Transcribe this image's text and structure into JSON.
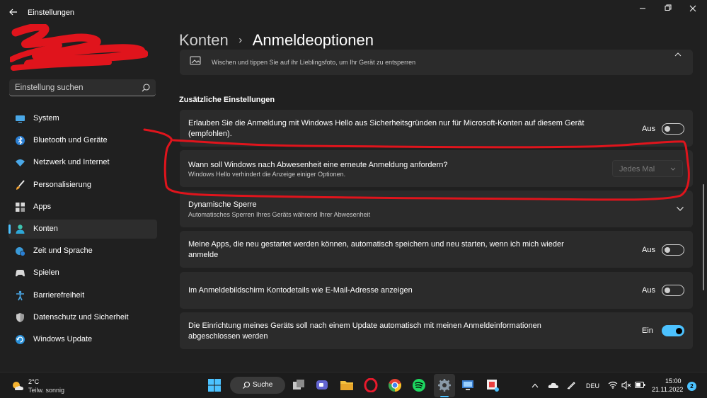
{
  "window": {
    "title": "Einstellungen"
  },
  "search": {
    "placeholder": "Einstellung suchen"
  },
  "sidebar": {
    "items": [
      {
        "label": "System",
        "icon": "monitor-icon"
      },
      {
        "label": "Bluetooth und Geräte",
        "icon": "bluetooth-icon"
      },
      {
        "label": "Netzwerk und Internet",
        "icon": "wifi-icon"
      },
      {
        "label": "Personalisierung",
        "icon": "brush-icon"
      },
      {
        "label": "Apps",
        "icon": "apps-icon"
      },
      {
        "label": "Konten",
        "icon": "person-icon",
        "active": true
      },
      {
        "label": "Zeit und Sprache",
        "icon": "globe-clock-icon"
      },
      {
        "label": "Spielen",
        "icon": "gamepad-icon"
      },
      {
        "label": "Barrierefreiheit",
        "icon": "accessibility-icon"
      },
      {
        "label": "Datenschutz und Sicherheit",
        "icon": "shield-icon"
      },
      {
        "label": "Windows Update",
        "icon": "update-icon"
      }
    ]
  },
  "header": {
    "parent": "Konten",
    "separator": "›",
    "current": "Anmeldeoptionen"
  },
  "main": {
    "partial_card_sub": "Wischen und tippen Sie auf ihr Lieblingsfoto, um Ihr Gerät zu entsperren",
    "section_title": "Zusätzliche Einstellungen",
    "hello_only": {
      "title": "Erlauben Sie die Anmeldung mit Windows Hello aus Sicherheitsgründen nur für Microsoft-Konten auf diesem Gerät (empfohlen).",
      "state": "Aus"
    },
    "reauth": {
      "title": "Wann soll Windows nach Abwesenheit eine erneute Anmeldung anfordern?",
      "sub": "Windows Hello verhindert die Anzeige einiger Optionen.",
      "value": "Jedes Mal"
    },
    "dynamic_lock": {
      "title": "Dynamische Sperre",
      "sub": "Automatisches Sperren Ihres Geräts während Ihrer Abwesenheit"
    },
    "restart_apps": {
      "title": "Meine Apps, die neu gestartet werden können, automatisch speichern und neu starten, wenn ich mich wieder anmelde",
      "state": "Aus"
    },
    "account_details": {
      "title": "Im Anmeldebildschirm Kontodetails wie E-Mail-Adresse anzeigen",
      "state": "Aus"
    },
    "finish_setup": {
      "title": "Die Einrichtung meines Geräts soll nach einem Update automatisch mit meinen Anmeldeinformationen abgeschlossen werden",
      "state": "Ein"
    }
  },
  "taskbar": {
    "weather_temp": "2°C",
    "weather_desc": "Teilw. sonnig",
    "search_label": "Suche",
    "language": "DEU",
    "time": "15:00",
    "date": "21.11.2022",
    "notifications": "2"
  },
  "colors": {
    "accent": "#4cc2ff",
    "annotation": "#e0141c",
    "background": "#202020",
    "card": "#2b2b2b"
  }
}
